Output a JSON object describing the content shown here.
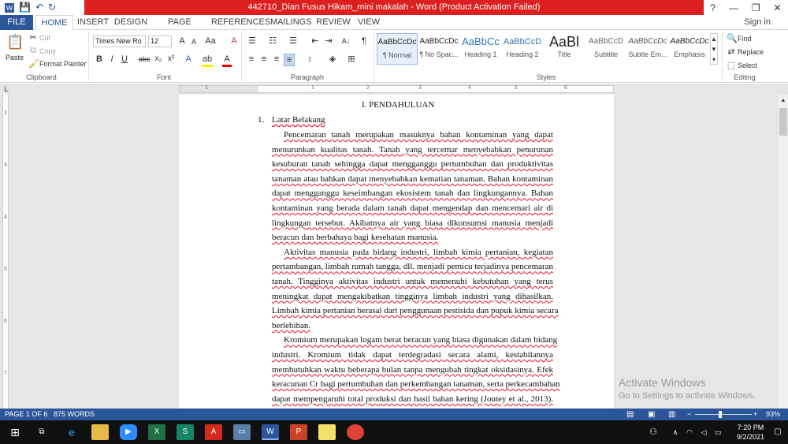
{
  "window": {
    "title": "442710_Dian Fusus Hikam_mini makalah - Word (Product Activation Failed)",
    "help": "?",
    "minimize": "—",
    "restore": "❐",
    "close": "✕",
    "colors": {
      "title_bar": "#dc1f1f",
      "accent": "#2b579a"
    }
  },
  "qat": {
    "save_icon": "💾",
    "undo_icon": "↶",
    "redo_icon": "↻"
  },
  "tabs": {
    "file": "FILE",
    "home": "HOME",
    "insert": "INSERT",
    "design": "DESIGN",
    "page_layout": "PAGE LAYOUT",
    "references": "REFERENCES",
    "mailings": "MAILINGS",
    "review": "REVIEW",
    "view": "VIEW",
    "sign_in": "Sign in"
  },
  "ribbon": {
    "clipboard": {
      "paste": "Paste",
      "cut": "Cut",
      "copy": "Copy",
      "format_painter": "Format Painter",
      "label": "Clipboard"
    },
    "font": {
      "name": "Times New Ro",
      "size": "12",
      "grow": "A",
      "shrink": "A",
      "case": "Aa",
      "label": "Font",
      "bold": "B",
      "italic": "I",
      "underline": "U",
      "strike": "abc",
      "sub": "x₂",
      "sup": "x²"
    },
    "paragraph": {
      "label": "Paragraph"
    },
    "styles": {
      "label": "Styles",
      "items": [
        {
          "preview": "AaBbCcDc",
          "name": "¶ Normal"
        },
        {
          "preview": "AaBbCcDc",
          "name": "¶ No Spac..."
        },
        {
          "preview": "AaBbCc",
          "name": "Heading 1"
        },
        {
          "preview": "AaBbCcD",
          "name": "Heading 2"
        },
        {
          "preview": "AaBl",
          "name": "Title"
        },
        {
          "preview": "AaBbCcD",
          "name": "Subtitle"
        },
        {
          "preview": "AaBbCcDc",
          "name": "Subtle Em..."
        },
        {
          "preview": "AaBbCcDc",
          "name": "Emphasis"
        }
      ]
    },
    "editing": {
      "find": "Find",
      "replace": "Replace",
      "select": "Select",
      "label": "Editing"
    }
  },
  "ruler": {
    "numbers": [
      "1",
      "1",
      "2",
      "3",
      "4",
      "5",
      "6"
    ],
    "vnumbers": [
      "2",
      "3",
      "4",
      "5",
      "6",
      "7"
    ]
  },
  "document": {
    "heading": "I.      PENDAHULUAN",
    "subheading_num": "1.",
    "subheading": "Latar Belakang",
    "lines": [
      "Pencemaran tanah merupakan masuknya bahan kontaminan yang dapat",
      "menurunkan kualitas tanah. Tanah yang tercemar menyebabkan penurunan",
      "kesuburan tanah sehingga dapat mengganggu pertumbuhan dan produktivitas",
      "tanaman atau bahkan dapat menyebabkan kematian tanaman. Bahan kontaminan",
      "dapat mengganggu keseimbangan ekosistem tanah dan lingkungannya. Bahan",
      "kontaminan yang berada dalam tanah dapat mengendap dan mencemari air di",
      "lingkungan tersebut. Akibatnya air yang biasa dikonsumsi manusia menjadi",
      "beracun dan berbahaya bagi kesehatan manusia.",
      "Aktivitas manusia pada bidang industri, limbah kimia pertanian, kegiatan",
      "pertambangan, limbah rumah tangga, dll. menjadi pemicu terjadinya pencemaran",
      "tanah. Tingginya aktivitas industri untuk memenuhi kebutuhan yang terus",
      "meningkat dapat mengakibatkan tingginya limbah industri yang dihasilkan.",
      "Limbah kimia pertanian berasal dari penggunaan pestisida dan pupuk kimia secara",
      "berlebihan.",
      "Kromium merupakan logam berat beracun yang biasa digunakan dalam bidang",
      "industri. Kromium tidak dapat terdegradasi secara alami, kestabilannya",
      "membutuhkan waktu beberapa bulan tanpa mengubah tingkat oksidasinya. Efek",
      "keracunan Cr bagi pertumbuhan dan perkembangan tanaman, serta perkecambahan",
      "dapat mempengaruhi total produksi dan hasil bahan kering (Joutey et al., 2013)."
    ],
    "activation_title": "Activate Windows",
    "activation_sub": "Go to Settings to activate Windows."
  },
  "status": {
    "page": "PAGE 1 OF 6",
    "words": "875 WORDS",
    "zoom": "93%",
    "zoom_minus": "−",
    "zoom_plus": "+"
  },
  "taskbar": {
    "time": "7:20 PM",
    "date": "9/2/2021",
    "apps": [
      "Start",
      "Task View",
      "Edge",
      "File Explorer",
      "Zoom",
      "Excel",
      "Sway",
      "Acrobat",
      "Remote",
      "Word",
      "PowerPoint",
      "Sticky Notes",
      "Chrome"
    ]
  }
}
